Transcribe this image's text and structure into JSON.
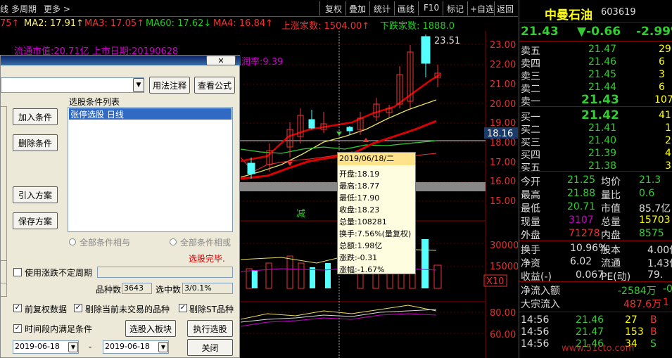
{
  "topbar": {
    "left_items": [
      "线",
      "多周期",
      "更多 >"
    ],
    "right_items": [
      "复权",
      "叠加",
      "统计",
      "画线",
      "F10",
      "标记",
      "+自选",
      "返回"
    ]
  },
  "ma_bar": {
    "ma1": "75↑",
    "ma2": "MA2: 17.91↑",
    "ma3": "MA3: 17.05↑",
    "ma60": "MA60: 17.62↓",
    "ma4": "MA4: 16.84↑",
    "up": "上涨家数: 1504.00↑",
    "down": "下跌家数: 1888.0",
    "back_text": "流通市值:20.71亿 上市日期:20190628",
    "profit": "润率:9.39"
  },
  "chart": {
    "peak_label": "23.51",
    "price_ticks": [
      "23.00",
      "22.00",
      "21.00",
      "20.00",
      "19.00",
      "18.00",
      "17.00",
      "16.00",
      "15.00"
    ],
    "current_price": "18.16",
    "vol_ticks": [
      "30000",
      "15000"
    ],
    "vol_unit": "X10",
    "osc_ticks": [
      "80.00",
      "60.00"
    ],
    "reduce_mark": "减"
  },
  "tooltip": {
    "date": "2019/06/18/二",
    "open": "开盘:18.19",
    "high": "最高:18.77",
    "low": "最低:17.90",
    "close": "收盘:18.23",
    "volume": "总量:108281",
    "turnover": "换手:7.56%(量复权)",
    "amount": "总额:1.98亿",
    "change": "涨跌:-0.31",
    "pct": "涨幅:-1.67%"
  },
  "quote": {
    "name": "中曼石油",
    "code": "603619",
    "price": "21.43",
    "change": "▼-0.66",
    "pct": "-2.99%",
    "asks": [
      {
        "label": "卖五",
        "price": "21.47",
        "vol": "29"
      },
      {
        "label": "卖四",
        "price": "21.46",
        "vol": "6"
      },
      {
        "label": "卖三",
        "price": "21.45",
        "vol": "3"
      },
      {
        "label": "卖二",
        "price": "21.44",
        "vol": "6"
      },
      {
        "label": "卖一",
        "price": "21.43",
        "vol": "107"
      }
    ],
    "bids": [
      {
        "label": "买一",
        "price": "21.42",
        "vol": "41"
      },
      {
        "label": "买二",
        "price": "21.41",
        "vol": "1"
      },
      {
        "label": "买三",
        "price": "21.40",
        "vol": "26"
      },
      {
        "label": "买四",
        "price": "21.39",
        "vol": "4"
      },
      {
        "label": "买五",
        "price": "21.38",
        "vol": "3"
      }
    ],
    "stats": [
      {
        "k1": "今开",
        "v1": "21.25",
        "k2": "均价",
        "v2": "21.3"
      },
      {
        "k1": "最高",
        "v1": "21.88",
        "k2": "量比",
        "v2": "0.6"
      },
      {
        "k1": "最低",
        "v1": "20.71",
        "k2": "市值",
        "v2": "85.7亿"
      },
      {
        "k1": "现量",
        "v1": "3107",
        "k2": "总量",
        "v2": "15703"
      },
      {
        "k1": "外盘",
        "v1": "71278",
        "k2": "内盘",
        "v2": "8575"
      }
    ],
    "stats2": [
      {
        "k1": "换手",
        "v1": "10.96%",
        "k2": "股本",
        "v2": "4.00亿"
      },
      {
        "k1": "净资",
        "v1": "6.02",
        "k2": "流通",
        "v2": "1.43亿"
      },
      {
        "k1": "收益(-)",
        "v1": "0.067",
        "k2": "PE(动)",
        "v2": "79."
      }
    ],
    "flow": [
      {
        "k": "净流入额",
        "v": "-2584万",
        "v2": "-0"
      },
      {
        "k": "大宗流入",
        "v": "487.6万",
        "v2": "1"
      }
    ],
    "ticks": [
      {
        "t": "14:56",
        "p": "21.46",
        "v": "27",
        "d": "B"
      },
      {
        "t": "14:56",
        "p": "21.47",
        "v": "153",
        "d": "B"
      },
      {
        "t": "14:56",
        "p": "21.46",
        "v": "34",
        "d": "S"
      }
    ]
  },
  "dialog": {
    "condition_list_title": "选股条件列表",
    "selected_condition": "张停选股  日线",
    "usage_btn": "用法注释",
    "view_formula_btn": "查看公式",
    "add_btn": "加入条件",
    "delete_btn": "删除条件",
    "import_btn": "引入方案",
    "save_btn": "保存方案",
    "radio_and": "全部条件相与",
    "radio_or": "全部条件相或",
    "status": "选股完毕.",
    "use_period": "使用涨跌不定周期",
    "count_label": "品种数",
    "count_value": "3643",
    "selected_label": "选中数",
    "selected_value": "3/0.1%",
    "prior_rights": "前复权数据",
    "exclude_untraded": "剔除当前未交易的品种",
    "exclude_st": "剔除ST品种",
    "time_range": "时间段内满足条件",
    "to_board_btn": "选股入板块",
    "run_btn": "执行选股",
    "date_from": "2019-06-18",
    "date_sep": "-",
    "date_to": "2019-06-18",
    "close_btn": "关闭"
  },
  "watermark": "www.51cto.com"
}
